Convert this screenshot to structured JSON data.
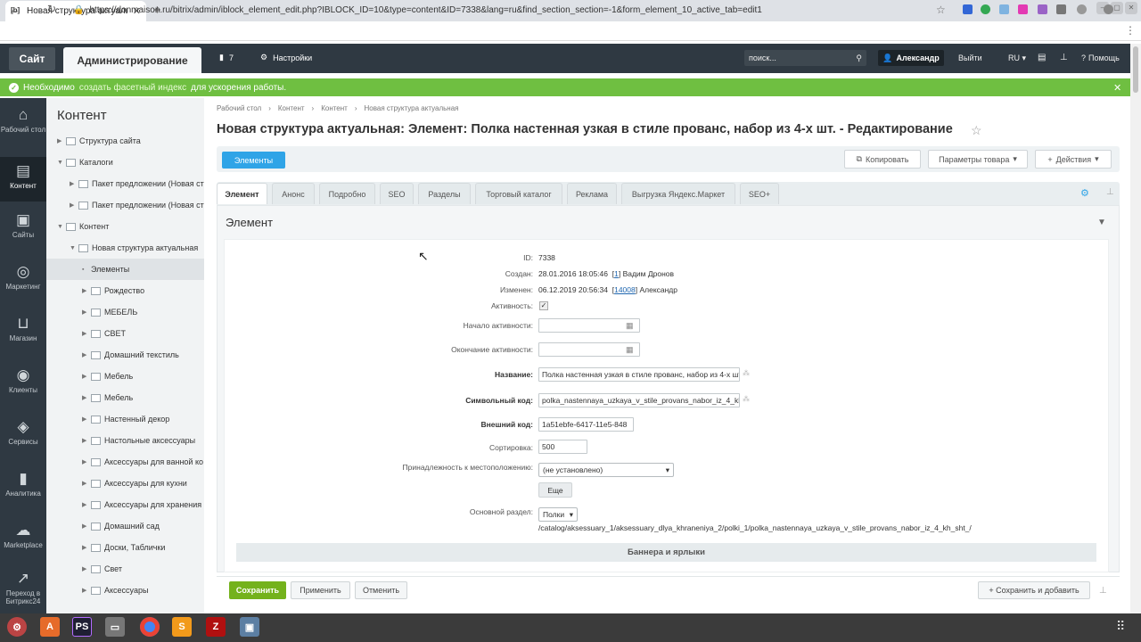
{
  "browser": {
    "tab_title": "Новая структура актуальн",
    "tab_favicon": "[b]",
    "url": "https://donmaison.ru/bitrix/admin/iblock_element_edit.php?IBLOCK_ID=10&type=content&ID=7338&lang=ru&find_section_section=-1&form_element_10_active_tab=edit1"
  },
  "topbar": {
    "site_label": "Сайт",
    "admin_label": "Администрирование",
    "notif_count": "7",
    "settings_label": "Настройки",
    "search_placeholder": "поиск...",
    "user_name": "Александр",
    "logout_label": "Выйти",
    "lang_label": "RU",
    "help_label": "Помощь"
  },
  "notice": {
    "prefix": "Необходимо",
    "link_text": "создать фасетный индекс",
    "suffix": "для ускорения работы."
  },
  "leftnav": {
    "items": [
      {
        "label": "Рабочий стол",
        "icon": "home-icon"
      },
      {
        "label": "Контент",
        "icon": "document-icon"
      },
      {
        "label": "Сайты",
        "icon": "calendar-24-icon"
      },
      {
        "label": "Маркетинг",
        "icon": "target-icon"
      },
      {
        "label": "Магазин",
        "icon": "basket-icon"
      },
      {
        "label": "Клиенты",
        "icon": "clients-icon"
      },
      {
        "label": "Сервисы",
        "icon": "layers-icon"
      },
      {
        "label": "Аналитика",
        "icon": "bar-chart-icon"
      },
      {
        "label": "Marketplace",
        "icon": "cloud-download-icon"
      },
      {
        "label": "Переход в Битрикс24",
        "icon": "external-link-icon"
      }
    ]
  },
  "tree": {
    "title": "Контент",
    "items": [
      {
        "label": "Структура сайта"
      },
      {
        "label": "Каталоги"
      },
      {
        "label": "Пакет предложении (Новая ст"
      },
      {
        "label": "Пакет предложении (Новая ст"
      },
      {
        "label": "Контент"
      },
      {
        "label": "Новая структура актуальная"
      },
      {
        "label": "Элементы"
      },
      {
        "label": "Рождество"
      },
      {
        "label": "МЕБЕЛЬ"
      },
      {
        "label": "СВЕТ"
      },
      {
        "label": "Домашний текстиль"
      },
      {
        "label": "Мебель"
      },
      {
        "label": "Мебель"
      },
      {
        "label": "Настенный декор"
      },
      {
        "label": "Настольные аксессуары"
      },
      {
        "label": "Аксессуары для ванной ко"
      },
      {
        "label": "Аксессуары для кухни"
      },
      {
        "label": "Аксессуары для хранения"
      },
      {
        "label": "Домашний сад"
      },
      {
        "label": "Доски, Таблички"
      },
      {
        "label": "Свет"
      },
      {
        "label": "Аксессуары"
      }
    ]
  },
  "breadcrumbs": [
    "Рабочий стол",
    "Контент",
    "Контент",
    "Новая структура актуальная"
  ],
  "page_title": "Новая структура актуальная: Элемент: Полка настенная узкая в стиле прованс, набор из 4-х шт. - Редактирование",
  "toolbar": {
    "elements": "Элементы",
    "copy": "Копировать",
    "product_params": "Параметры товара",
    "actions": "Действия"
  },
  "tabs": [
    "Элемент",
    "Анонс",
    "Подробно",
    "SEO",
    "Разделы",
    "Торговый каталог",
    "Реклама",
    "Выгрузка Яндекс.Маркет",
    "SEO+"
  ],
  "section": {
    "title": "Элемент"
  },
  "form": {
    "id_label": "ID:",
    "id_value": "7338",
    "created_label": "Создан:",
    "created_value": "28.01.2016 18:05:46",
    "created_user_id": "1",
    "created_user": "Вадим Дронов",
    "modified_label": "Изменен:",
    "modified_value": "06.12.2019 20:56:34",
    "modified_user_id": "14008",
    "modified_user": "Александр",
    "active_label": "Активность:",
    "active_from_label": "Начало активности:",
    "active_to_label": "Окончание активности:",
    "name_label": "Название:",
    "name_value": "Полка настенная узкая в стиле прованс, набор из 4-х шт.",
    "code_label": "Символьный код:",
    "code_value": "polka_nastennaya_uzkaya_v_stile_provans_nabor_iz_4_kh_sht_",
    "xml_label": "Внешний код:",
    "xml_value": "1a51ebfe-6417-11e5-848",
    "sort_label": "Сортировка:",
    "sort_value": "500",
    "location_label": "Принадлежность к местоположению:",
    "location_value": "(не установлено)",
    "more_label": "Еще",
    "main_section_label": "Основной раздел:",
    "main_section_value": "Полки",
    "section_path": "/catalog/aksessuary_1/aksessuary_dlya_khraneniya_2/polki_1/polka_nastennaya_uzkaya_v_stile_provans_nabor_iz_4_kh_sht_/",
    "banners_heading": "Баннера и ярлыки"
  },
  "footer": {
    "save": "Сохранить",
    "apply": "Применить",
    "cancel": "Отменить",
    "save_add": "Сохранить и добавить"
  },
  "colors": {
    "accent": "#2fa4e7",
    "notice": "#6fbf41",
    "save": "#74b21c",
    "topbar": "#2f3942"
  }
}
